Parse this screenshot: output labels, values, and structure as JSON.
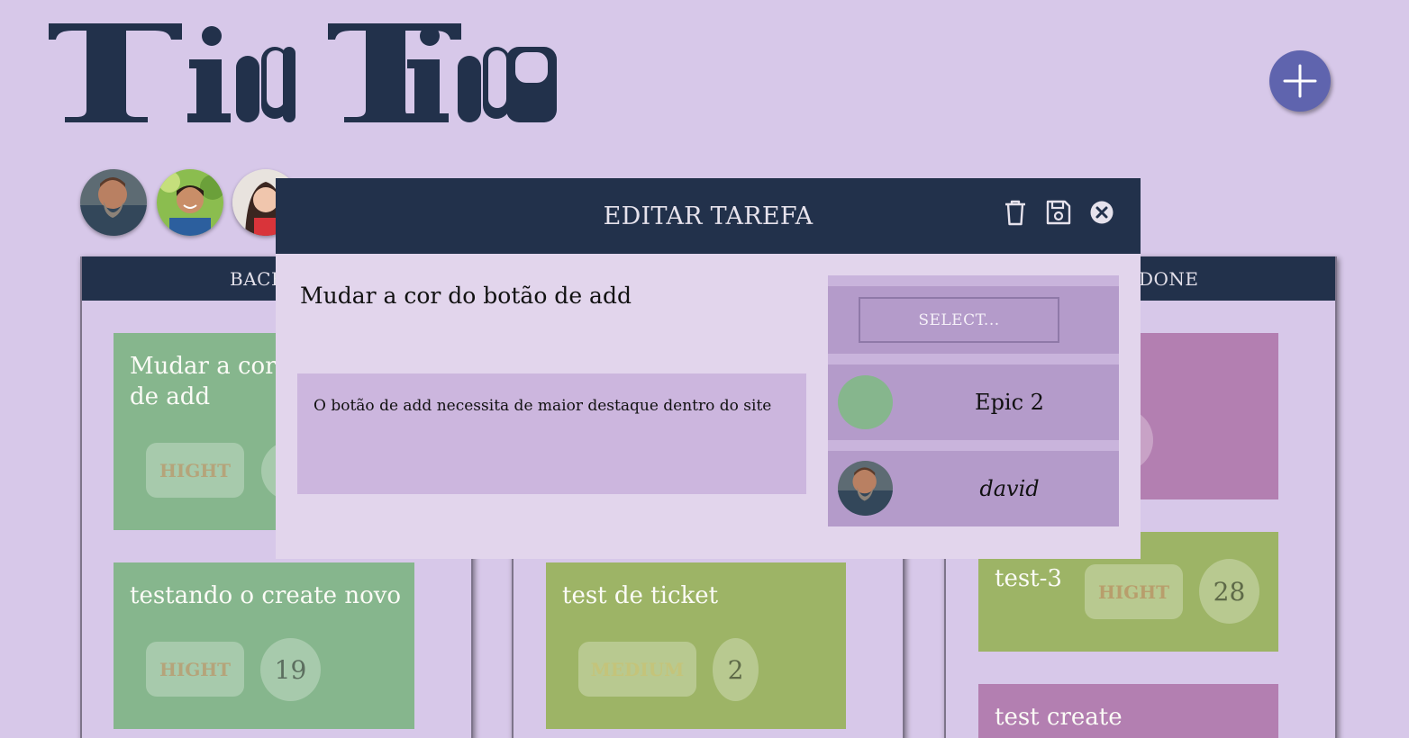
{
  "app": {
    "logo_text": "TimTim",
    "add_button_label": "+"
  },
  "columns": [
    {
      "title": "BACKLOG"
    },
    {
      "title": ""
    },
    {
      "title": "DONE"
    }
  ],
  "cards": {
    "backlog": [
      {
        "title": "Mudar a cor do botão de add",
        "priority": "HIGHT",
        "points": ""
      },
      {
        "title": "testando o create novo",
        "priority": "HIGHT",
        "points": "19"
      }
    ],
    "mid": [
      {
        "title": "test de ticket",
        "priority": "MEDIUM",
        "points": "2"
      }
    ],
    "done": [
      {
        "title": "",
        "priority": "",
        "points": ""
      },
      {
        "title": "test-3",
        "priority": "HIGHT",
        "points": "28"
      },
      {
        "title": "test create",
        "priority": "",
        "points": ""
      }
    ]
  },
  "modal": {
    "title": "EDITAR TAREFA",
    "task_title": "Mudar a cor do botão de add",
    "description": "O botão de add necessita de maior destaque dentro do site",
    "select_placeholder": "SELECT...",
    "epic_label": "Epic 2",
    "epic_color": "#86b68d",
    "assignee": "david",
    "actions": [
      "trash-icon",
      "save-icon",
      "close-icon"
    ]
  },
  "colors": {
    "background": "#d7c8e9",
    "header_navy": "#22314b",
    "add_button": "#5f64ae",
    "card_green": "#86b68d",
    "card_olive": "#9db466",
    "card_mauve": "#b37fb1"
  }
}
